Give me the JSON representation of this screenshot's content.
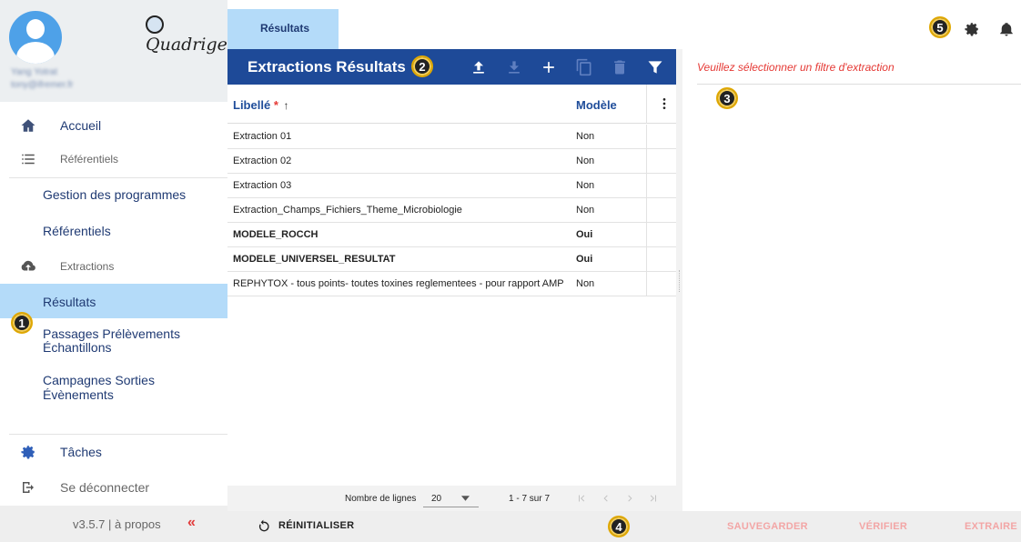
{
  "app": {
    "logo_text": "Quadrige"
  },
  "sidebar": {
    "user_name": "Yang Yotrat",
    "user_email": "tony@ifremer.fr",
    "items": {
      "accueil": "Accueil",
      "referentiels_group": "Référentiels",
      "gestion_programmes": "Gestion des programmes",
      "referentiels": "Référentiels",
      "extractions_group": "Extractions",
      "resultats": "Résultats",
      "passages_line1": "Passages Prélèvements",
      "passages_line2": "Échantillons",
      "campagnes": "Campagnes Sorties Évènements",
      "taches": "Tâches",
      "deconnecter": "Se déconnecter"
    },
    "footer": {
      "version": "v3.5.7 | à propos",
      "collapse": "«"
    }
  },
  "tab": {
    "label": "Résultats"
  },
  "panel": {
    "title": "Extractions Résultats",
    "columns": {
      "libelle": "Libellé",
      "required_mark": "*",
      "sort_arrow": "↑",
      "modele": "Modèle"
    },
    "rows": [
      {
        "libelle": "Extraction 01",
        "modele": "Non",
        "bold": false
      },
      {
        "libelle": "Extraction 02",
        "modele": "Non",
        "bold": false
      },
      {
        "libelle": "Extraction 03",
        "modele": "Non",
        "bold": false
      },
      {
        "libelle": "Extraction_Champs_Fichiers_Theme_Microbiologie",
        "modele": "Non",
        "bold": false
      },
      {
        "libelle": "MODELE_ROCCH",
        "modele": "Oui",
        "bold": true
      },
      {
        "libelle": "MODELE_UNIVERSEL_RESULTAT",
        "modele": "Oui",
        "bold": true
      },
      {
        "libelle": "REPHYTOX - tous points- toutes toxines reglementees - pour rapport AMP",
        "modele": "Non",
        "bold": false
      }
    ],
    "paginator": {
      "label": "Nombre de lignes",
      "page_size": "20",
      "range": "1 - 7 sur 7"
    }
  },
  "filter": {
    "message": "Veuillez sélectionner un filtre d'extraction"
  },
  "actions": {
    "reset": "RÉINITIALISER",
    "save": "SAUVEGARDER",
    "verify": "VÉRIFIER",
    "extract": "EXTRAIRE"
  },
  "markers": {
    "m1": "1",
    "m2": "2",
    "m3": "3",
    "m4": "4",
    "m5": "5"
  },
  "colors": {
    "primary": "#1e4a98",
    "active_tab": "#b4dbf9",
    "error": "#e53935",
    "disabled_action": "#f3a5a5"
  }
}
